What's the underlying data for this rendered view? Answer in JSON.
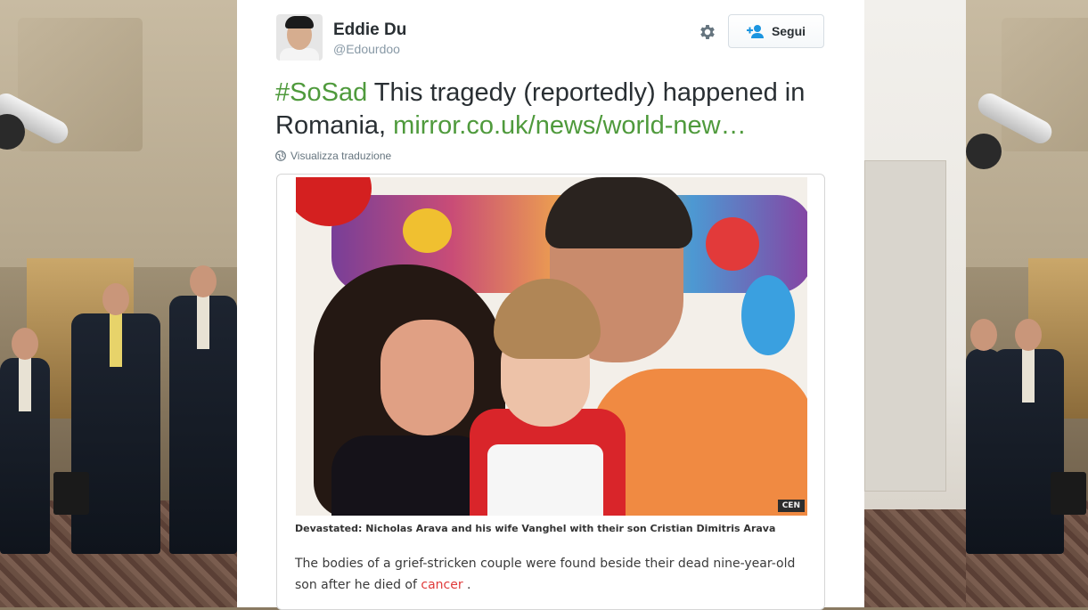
{
  "tweet": {
    "author_name": "Eddie Du",
    "author_handle": "@Edourdoo",
    "follow_label": "Segui",
    "hashtag": "#SoSad",
    "text": " This tragedy (reportedly) happened in Romania, ",
    "link": "mirror.co.uk/news/world-new…",
    "translate_label": "Visualizza traduzione"
  },
  "article": {
    "photo_credit": "CEN",
    "caption": "Devastated: Nicholas Arava and his wife Vanghel with their son Cristian Dimitris Arava",
    "body_start": "The bodies of a grief-stricken couple were found beside their dead nine-year-old son after he died of",
    "body_link": "cancer",
    "body_end": " ."
  },
  "icons": {
    "gear": "gear-icon",
    "follow": "add-user-icon",
    "globe": "globe-icon"
  },
  "colors": {
    "accent_green": "#4f9a3c",
    "text_dark": "#292f33",
    "muted": "#8899a6",
    "link_red": "#e03a3a"
  }
}
